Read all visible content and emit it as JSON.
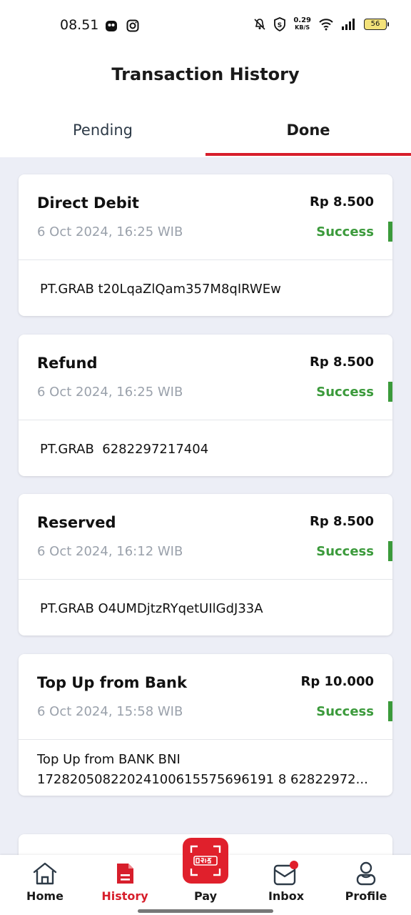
{
  "status_bar": {
    "time": "08.51",
    "net_speed_value": "0.29",
    "net_speed_unit": "KB/S",
    "battery": "56"
  },
  "header": {
    "title": "Transaction History"
  },
  "tabs": [
    {
      "label": "Pending",
      "active": false
    },
    {
      "label": "Done",
      "active": true
    }
  ],
  "transactions": [
    {
      "type": "Direct Debit",
      "amount": "Rp 8.500",
      "date": "6 Oct 2024, 16:25 WIB",
      "status": "Success",
      "description": "PT.GRAB t20LqaZlQam357M8qIRWEw"
    },
    {
      "type": "Refund",
      "amount": "Rp 8.500",
      "date": "6 Oct 2024, 16:25 WIB",
      "status": "Success",
      "description": "PT.GRAB  6282297217404"
    },
    {
      "type": "Reserved",
      "amount": "Rp 8.500",
      "date": "6 Oct 2024, 16:12 WIB",
      "status": "Success",
      "description": "PT.GRAB O4UMDjtzRYqetUIlGdJ33A"
    },
    {
      "type": "Top Up from Bank",
      "amount": "Rp 10.000",
      "date": "6 Oct 2024, 15:58 WIB",
      "status": "Success",
      "description_line1": "Top Up from BANK BNI",
      "description_line2": "17282050822024100615575696191 8  62822972..."
    }
  ],
  "bottom_nav": [
    {
      "label": "Home",
      "icon": "home-icon",
      "active": false
    },
    {
      "label": "History",
      "icon": "history-icon",
      "active": true
    },
    {
      "label": "Pay",
      "icon": "qris-icon",
      "active": false
    },
    {
      "label": "Inbox",
      "icon": "inbox-icon",
      "active": false,
      "badge": true
    },
    {
      "label": "Profile",
      "icon": "profile-icon",
      "active": false
    }
  ],
  "colors": {
    "accent": "#d71e2b",
    "success": "#3b9a3b",
    "background": "#eceef6"
  }
}
